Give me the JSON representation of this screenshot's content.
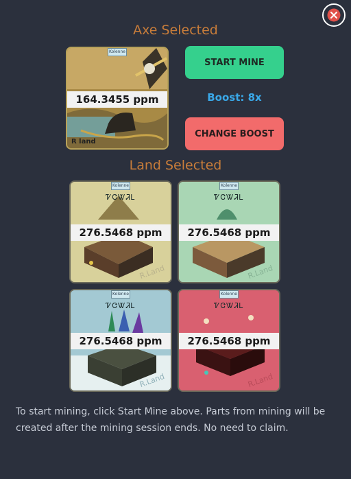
{
  "modal": {
    "axe_title": "Axe Selected",
    "land_title": "Land Selected",
    "footer_text": "To start mining, click Start Mine above. Parts from mining will be created after the mining session ends. No need to claim."
  },
  "axe": {
    "ppm": "164.3455 ppm",
    "badge": "Kolenne",
    "brand": "R land"
  },
  "actions": {
    "start_label": "START MINE",
    "boost_label": "Boost: 8x",
    "change_label": "CHANGE BOOST"
  },
  "lands": [
    {
      "ppm": "276.5468 ppm",
      "script": "ᏤᏣᏔᏘᏞ",
      "badge": "Kolenne",
      "watermark": "R.Land",
      "color": "#d8d19b"
    },
    {
      "ppm": "276.5468 ppm",
      "script": "ᏤᏣᏔᏘᏞ",
      "badge": "Kolenne",
      "watermark": "R.Land",
      "color": "#a9d6b4"
    },
    {
      "ppm": "276.5468 ppm",
      "script": "ᏤᏣᏔᏘᏞ",
      "badge": "Kolenne",
      "watermark": "R.Land",
      "color": "#a3c9d3"
    },
    {
      "ppm": "276.5468 ppm",
      "script": "ᏤᏣᏔᏘᏞ",
      "badge": "Kolenne",
      "watermark": "R.Land",
      "color": "#d96070"
    }
  ],
  "colors": {
    "accent_orange": "#c97d3a",
    "start_green": "#35d08d",
    "change_red": "#f26b6b",
    "boost_blue": "#3aa8e8",
    "background": "#2b303d"
  }
}
